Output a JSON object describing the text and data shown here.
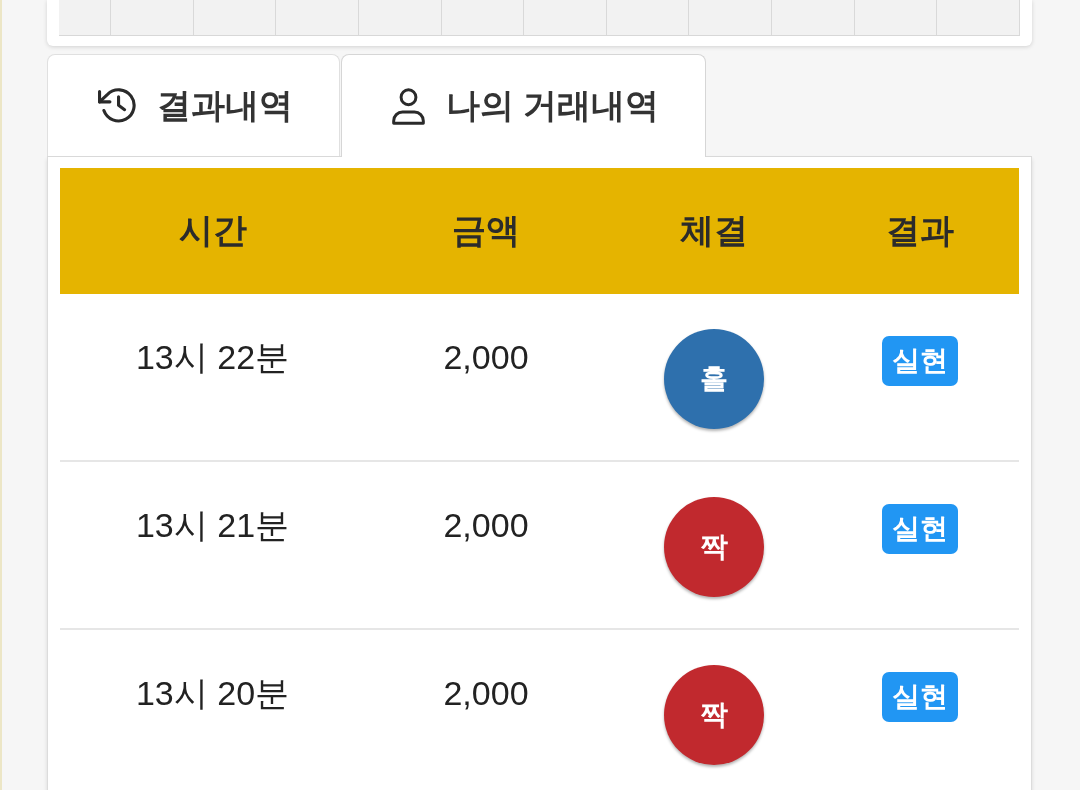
{
  "tabs": [
    {
      "label": "결과내역",
      "selected": false
    },
    {
      "label": "나의 거래내역",
      "selected": true
    }
  ],
  "table": {
    "columns": [
      "시간",
      "금액",
      "체결",
      "결과"
    ],
    "rows": [
      {
        "time": "13시 22분",
        "amount": "2,000",
        "pick": {
          "label": "홀",
          "color": "#2e70ad"
        },
        "result": "실현"
      },
      {
        "time": "13시 21분",
        "amount": "2,000",
        "pick": {
          "label": "짝",
          "color": "#c1292e"
        },
        "result": "실현"
      },
      {
        "time": "13시 20분",
        "amount": "2,000",
        "pick": {
          "label": "짝",
          "color": "#c1292e"
        },
        "result": "실현"
      }
    ]
  }
}
